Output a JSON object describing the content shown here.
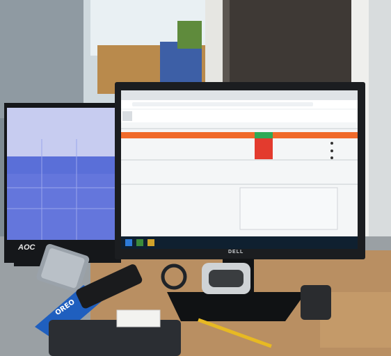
{
  "brands": {
    "left_monitor": "AOC",
    "right_monitor": "DELL",
    "snack_package": "OREO"
  },
  "colors": {
    "wall": "#7c8a93",
    "window_sky": "#dfeaf0",
    "orange_bar": "#f06a2a",
    "red_cell": "#e33b2e",
    "green_cell": "#2eaa55",
    "desk_wood": "#b88d5f",
    "tray_wood": "#8c6a45",
    "monitor_black": "#1a1c1f",
    "screen_blue": "#5a6fd8"
  }
}
